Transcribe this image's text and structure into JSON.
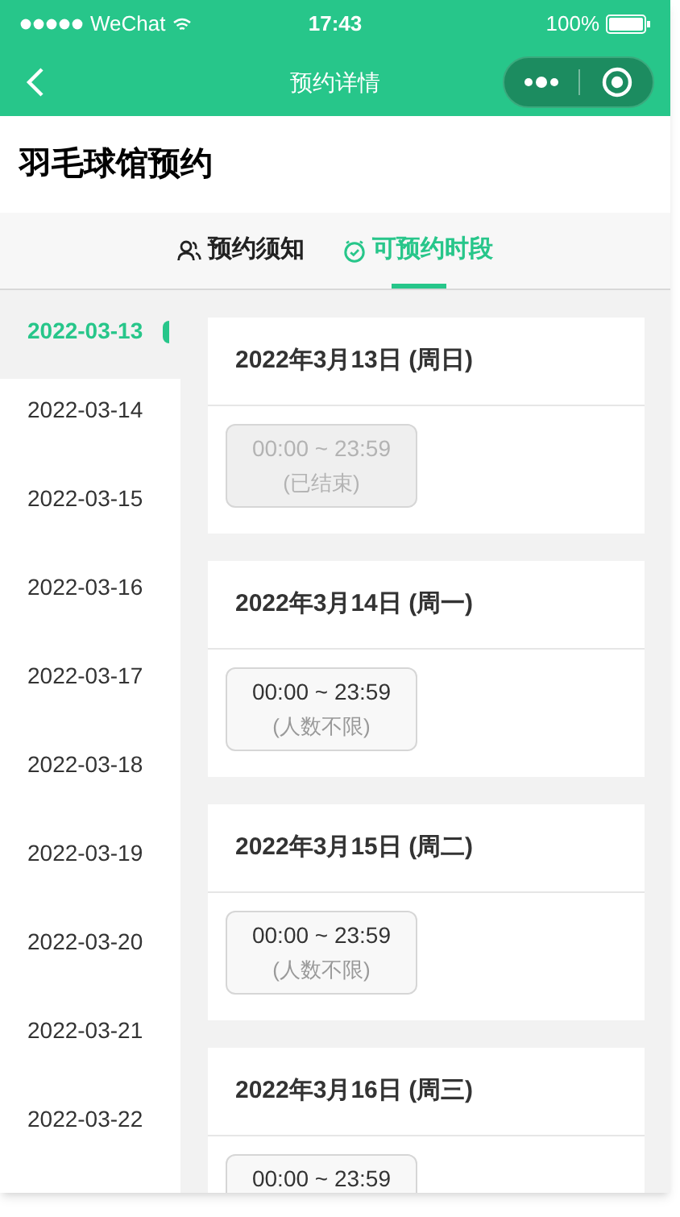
{
  "status_bar": {
    "carrier": "WeChat",
    "time": "17:43",
    "battery": "100%"
  },
  "nav": {
    "title": "预约详情"
  },
  "header": {
    "title": "羽毛球馆预约"
  },
  "tabs": [
    {
      "label": "预约须知",
      "kind": "people",
      "selected": false
    },
    {
      "label": "可预约时段",
      "kind": "clock",
      "selected": true
    }
  ],
  "dates": [
    {
      "label": "2022-03-13",
      "selected": true
    },
    {
      "label": "2022-03-14",
      "selected": false
    },
    {
      "label": "2022-03-15",
      "selected": false
    },
    {
      "label": "2022-03-16",
      "selected": false
    },
    {
      "label": "2022-03-17",
      "selected": false
    },
    {
      "label": "2022-03-18",
      "selected": false
    },
    {
      "label": "2022-03-19",
      "selected": false
    },
    {
      "label": "2022-03-20",
      "selected": false
    },
    {
      "label": "2022-03-21",
      "selected": false
    },
    {
      "label": "2022-03-22",
      "selected": false
    }
  ],
  "days": [
    {
      "title": "2022年3月13日 (周日)",
      "slots": [
        {
          "time": "00:00 ~ 23:59",
          "note": "(已结束)",
          "disabled": true
        }
      ]
    },
    {
      "title": "2022年3月14日 (周一)",
      "slots": [
        {
          "time": "00:00 ~ 23:59",
          "note": "(人数不限)",
          "disabled": false
        }
      ]
    },
    {
      "title": "2022年3月15日 (周二)",
      "slots": [
        {
          "time": "00:00 ~ 23:59",
          "note": "(人数不限)",
          "disabled": false
        }
      ]
    },
    {
      "title": "2022年3月16日 (周三)",
      "slots": [
        {
          "time": "00:00 ~ 23:59",
          "disabled": false
        }
      ]
    }
  ]
}
